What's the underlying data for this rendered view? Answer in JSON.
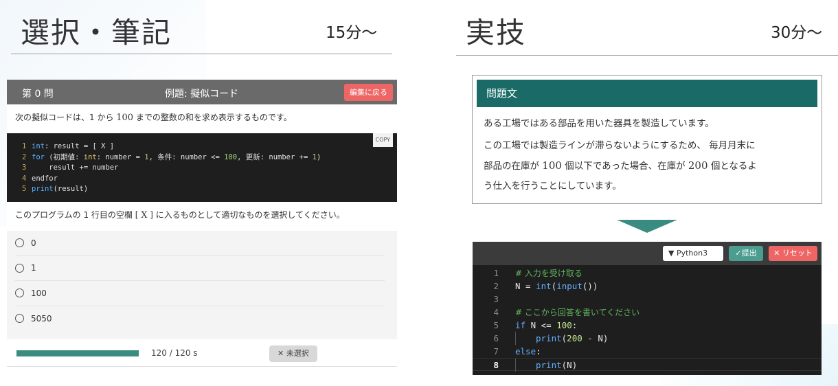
{
  "left_section": {
    "title": "選択・筆記",
    "time": "15分〜",
    "quiz": {
      "number": "第 0 問",
      "title": "例題: 擬似コード",
      "back_label": "編集に戻る",
      "question_prefix": "次の擬似コードは、1 から ",
      "question_num": "100",
      "question_suffix": " までの整数の和を求め表示するものです。",
      "copy_label": "COPY",
      "code_lines": [
        {
          "n": "1",
          "html": "<span class=\"kw\">int</span>: result = [ X ]"
        },
        {
          "n": "2",
          "html": "<span class=\"kw\">for</span> (初期値: <span class=\"ty\">int</span>: number = <span class=\"nm\">1</span>, 条件: number &lt;= <span class=\"nm\">100</span>, 更新: number += <span class=\"nm\">1</span>)"
        },
        {
          "n": "3",
          "html": "    result += number"
        },
        {
          "n": "4",
          "html": "endfor"
        },
        {
          "n": "5",
          "html": "<span class=\"kw\">print</span>(result)"
        }
      ],
      "prompt_prefix": "このプログラムの 1 行目の空欄 [ ",
      "prompt_blank": "X",
      "prompt_suffix": " ] に入るものとして適切なものを選択してください。",
      "choices": [
        "0",
        "1",
        "100",
        "5050"
      ],
      "timer": "120 / 120 s",
      "progress_fraction": 1.0,
      "unselected_label": "✕ 未選択"
    }
  },
  "right_section": {
    "title": "実技",
    "time": "30分〜",
    "problem": {
      "heading": "問題文",
      "para1": "ある工場ではある部品を用いた器具を製造しています。",
      "para2_a": "この工場では製造ラインが滞らないようにするため、 毎月月末に",
      "para2_b1": "部品の在庫が ",
      "para2_num1": "100",
      "para2_b2": " 個以下であった場合、在庫が ",
      "para2_num2": "200",
      "para2_b3": " 個となるよ",
      "para2_c": "う仕入を行うことにしています。"
    },
    "editor": {
      "language": "▼ Python3",
      "submit_label": "✓提出",
      "reset_label": "✕ リセット",
      "lines": [
        {
          "n": "1",
          "html": "<span class=\"cm\"># 入力を受け取る</span>"
        },
        {
          "n": "2",
          "html": "N = <span class=\"fn\">int</span>(<span class=\"fn\">input</span>())"
        },
        {
          "n": "3",
          "html": ""
        },
        {
          "n": "4",
          "html": "<span class=\"cm\"># ここから回答を書いてください</span>"
        },
        {
          "n": "5",
          "html": "<span class=\"fn\">if</span> N &lt;= <span class=\"nb\">100</span>:"
        },
        {
          "n": "6",
          "html": "<span class=\"guide\"></span><span class=\"fn\">print</span>(<span class=\"nb\">200</span> - N)"
        },
        {
          "n": "7",
          "html": "<span class=\"fn\">else</span>:"
        },
        {
          "n": "8",
          "html": "<span class=\"guide\"></span><span class=\"fn\">print</span>(N)"
        }
      ],
      "active_line": 8
    }
  }
}
